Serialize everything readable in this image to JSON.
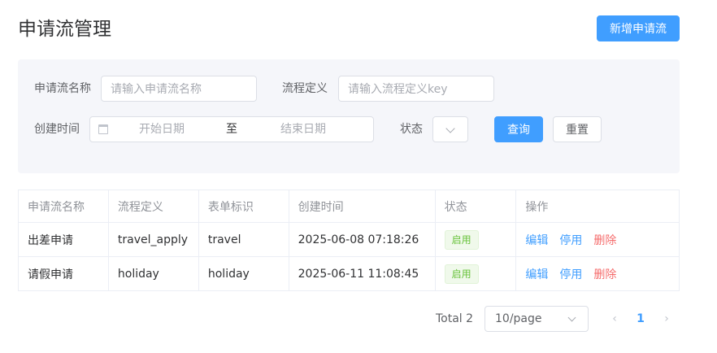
{
  "page": {
    "title": "申请流管理",
    "add_button": "新增申请流"
  },
  "filters": {
    "name_label": "申请流名称",
    "name_placeholder": "请输入申请流名称",
    "def_label": "流程定义",
    "def_placeholder": "请输入流程定义key",
    "created_label": "创建时间",
    "date_start_placeholder": "开始日期",
    "date_separator": "至",
    "date_end_placeholder": "结束日期",
    "status_label": "状态",
    "query_button": "查询",
    "reset_button": "重置"
  },
  "table": {
    "columns": [
      "申请流名称",
      "流程定义",
      "表单标识",
      "创建时间",
      "状态",
      "操作"
    ],
    "rows": [
      {
        "name": "出差申请",
        "def": "travel_apply",
        "form": "travel",
        "created": "2025-06-08 07:18:26",
        "status": "启用",
        "edit": "编辑",
        "disable": "停用",
        "delete": "删除"
      },
      {
        "name": "请假申请",
        "def": "holiday",
        "form": "holiday",
        "created": "2025-06-11 11:08:45",
        "status": "启用",
        "edit": "编辑",
        "disable": "停用",
        "delete": "删除"
      }
    ]
  },
  "pagination": {
    "total": "Total 2",
    "page_size": "10/page",
    "prev": "‹",
    "current_page": "1",
    "next": "›"
  },
  "colors": {
    "primary": "#409eff",
    "success": "#67c23a",
    "danger": "#f56c6c",
    "panel_bg": "#f5f6fa"
  },
  "icons": {
    "date": "calendar-icon",
    "select": "chevron-down-icon"
  }
}
